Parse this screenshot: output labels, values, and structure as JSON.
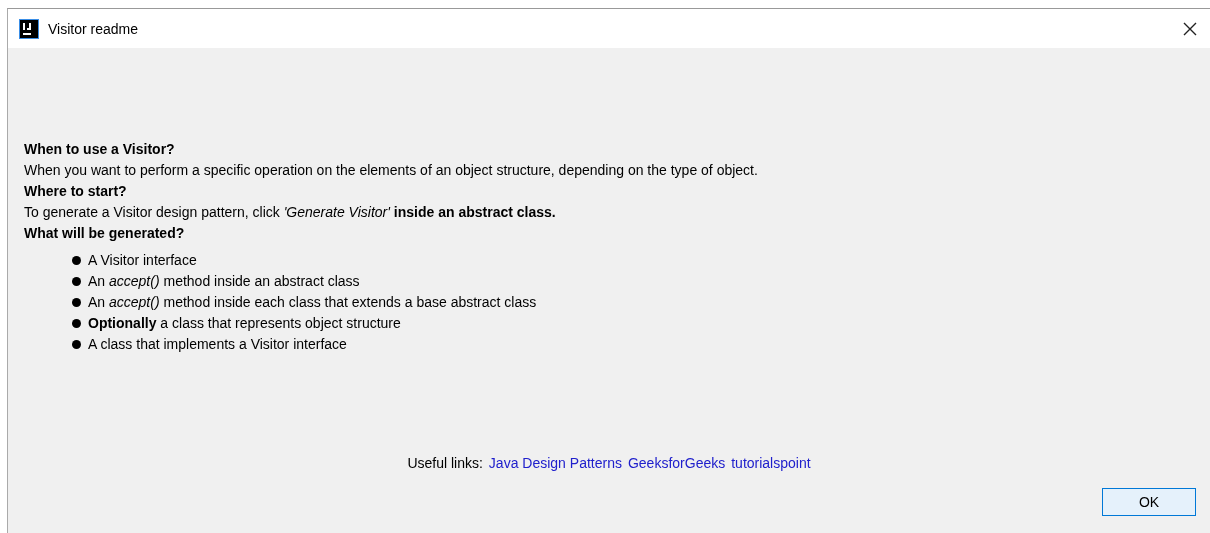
{
  "window": {
    "title": "Visitor readme"
  },
  "content": [
    {
      "kind": "heading",
      "text": "When to use a Visitor?"
    },
    {
      "kind": "text",
      "text": "When you want to perform a specific operation on the elements of an object structure, depending on the type of object."
    },
    {
      "kind": "heading",
      "text": "Where to start?"
    },
    {
      "kind": "text",
      "text": "To generate a Visitor design pattern, click *'Generate Visitor'* **inside an abstract class.**"
    },
    {
      "kind": "heading",
      "text": "What will be generated?"
    }
  ],
  "bullets": [
    "A Visitor interface",
    "An *accept()* method inside an abstract class",
    "An *accept()* method inside each class that extends a base abstract class",
    "**Optionally** a class that represents object structure",
    "A class that implements a Visitor interface"
  ],
  "links": {
    "label": "Useful links:",
    "items": [
      "Java Design Patterns",
      "GeeksforGeeks",
      "tutorialspoint"
    ]
  },
  "buttons": [
    "OK"
  ]
}
